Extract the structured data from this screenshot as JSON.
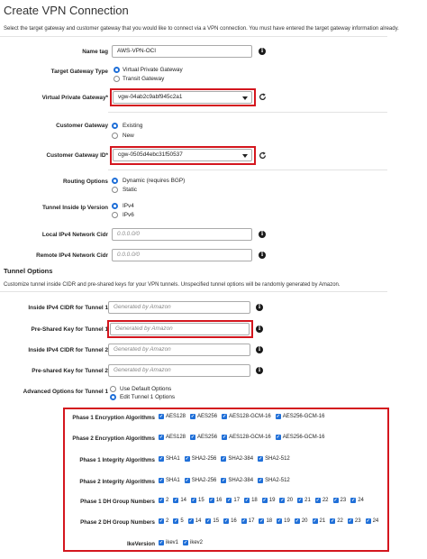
{
  "page": {
    "title": "Create VPN Connection",
    "description": "Select the target gateway and customer gateway that you would like to connect via a VPN connection. You must have entered the target gateway information already."
  },
  "form": {
    "name_tag": {
      "label": "Name tag",
      "value": "AWS-VPN-OCI"
    },
    "target_gateway_type": {
      "label": "Target Gateway Type",
      "options": [
        "Virtual Private Gateway",
        "Transit Gateway"
      ],
      "selected": "Virtual Private Gateway"
    },
    "virtual_private_gateway": {
      "label": "Virtual Private Gateway*",
      "value": "vgw-04ab2c9abf945c2a1"
    },
    "customer_gateway": {
      "label": "Customer Gateway",
      "options": [
        "Existing",
        "New"
      ],
      "selected": "Existing"
    },
    "customer_gateway_id": {
      "label": "Customer Gateway ID*",
      "value": "cgw-0505d4ebc31f50537"
    },
    "routing_options": {
      "label": "Routing Options",
      "options": [
        "Dynamic (requires BGP)",
        "Static"
      ],
      "selected": "Dynamic (requires BGP)"
    },
    "tunnel_inside_ip_version": {
      "label": "Tunnel Inside Ip Version",
      "options": [
        "IPv4",
        "IPv6"
      ],
      "selected": "IPv4"
    },
    "local_cidr": {
      "label": "Local IPv4 Network Cidr",
      "placeholder": "0.0.0.0/0"
    },
    "remote_cidr": {
      "label": "Remote IPv4 Network Cidr",
      "placeholder": "0.0.0.0/0"
    }
  },
  "tunnel": {
    "heading": "Tunnel Options",
    "description": "Customize tunnel inside CIDR and pre-shared keys for your VPN tunnels. Unspecified tunnel options will be randomly generated by Amazon.",
    "inside_cidr_1": {
      "label": "Inside IPv4 CIDR for Tunnel 1",
      "placeholder": "Generated by Amazon"
    },
    "psk_1": {
      "label": "Pre-Shared Key for Tunnel 1",
      "placeholder": "Generated by Amazon"
    },
    "inside_cidr_2": {
      "label": "Inside IPv4 CIDR for Tunnel 2",
      "placeholder": "Generated by Amazon"
    },
    "psk_2": {
      "label": "Pre-shared Key for Tunnel 2",
      "placeholder": "Generated by Amazon"
    },
    "advanced": {
      "label": "Advanced Options for Tunnel 1",
      "options": [
        "Use Default Options",
        "Edit Tunnel 1 Options"
      ],
      "selected": "Edit Tunnel 1 Options"
    }
  },
  "phase": {
    "p1_enc": {
      "label": "Phase 1 Encryption Algorithms",
      "items": [
        "AES128",
        "AES256",
        "AES128-GCM-16",
        "AES256-GCM-16"
      ]
    },
    "p2_enc": {
      "label": "Phase 2 Encryption Algorithms",
      "items": [
        "AES128",
        "AES256",
        "AES128-GCM-16",
        "AES256-GCM-16"
      ]
    },
    "p1_int": {
      "label": "Phase 1 Integrity Algorithms",
      "items": [
        "SHA1",
        "SHA2-256",
        "SHA2-384",
        "SHA2-512"
      ]
    },
    "p2_int": {
      "label": "Phase 2 Integrity Algorithms",
      "items": [
        "SHA1",
        "SHA2-256",
        "SHA2-384",
        "SHA2-512"
      ]
    },
    "p1_dh": {
      "label": "Phase 1 DH Group Numbers",
      "items": [
        "2",
        "14",
        "15",
        "16",
        "17",
        "18",
        "19",
        "20",
        "21",
        "22",
        "23",
        "24"
      ]
    },
    "p2_dh": {
      "label": "Phase 2 DH Group Numbers",
      "items": [
        "2",
        "5",
        "14",
        "15",
        "16",
        "17",
        "18",
        "19",
        "20",
        "21",
        "22",
        "23",
        "24"
      ]
    },
    "ike": {
      "label": "IkeVersion",
      "items": [
        "ikev1",
        "ikev2"
      ]
    }
  },
  "icons": {
    "info": "info-icon",
    "refresh": "refresh-icon",
    "check": "✓"
  },
  "colors": {
    "highlight": "#d4161e",
    "accent": "#1f6fd8"
  }
}
